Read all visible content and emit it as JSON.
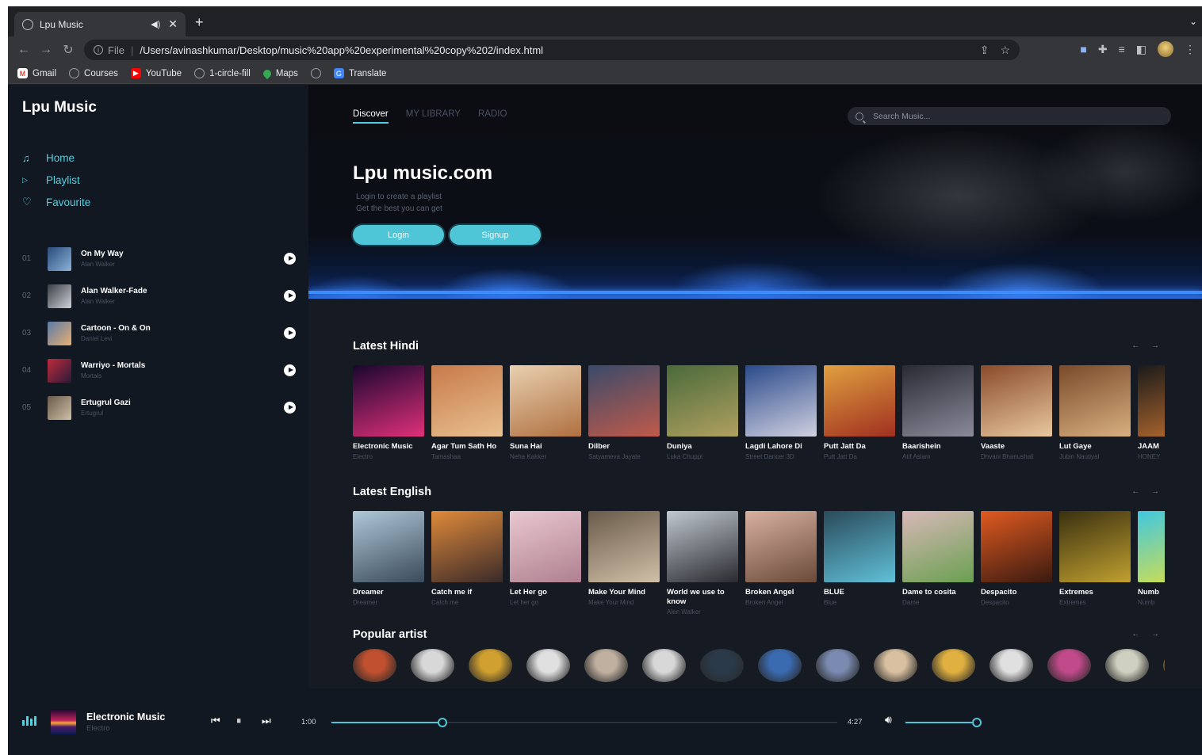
{
  "browser": {
    "tab_title": "Lpu Music",
    "new_tab": "+",
    "url_scheme": "File",
    "url": "/Users/avinashkumar/Desktop/music%20app%20experimental%20copy%202/index.html",
    "bookmarks": [
      {
        "label": "Gmail",
        "icon": "gmail-icon"
      },
      {
        "label": "Courses",
        "icon": "globe-icon"
      },
      {
        "label": "YouTube",
        "icon": "youtube-icon"
      },
      {
        "label": "1-circle-fill",
        "icon": "globe-icon"
      },
      {
        "label": "Maps",
        "icon": "maps-icon"
      },
      {
        "label": "",
        "icon": "globe-icon"
      },
      {
        "label": "Translate",
        "icon": "translate-icon"
      }
    ]
  },
  "sidebar": {
    "brand": "Lpu Music",
    "nav": [
      {
        "label": "Home",
        "icon": "music-note-icon"
      },
      {
        "label": "Playlist",
        "icon": "play-icon"
      },
      {
        "label": "Favourite",
        "icon": "heart-icon"
      }
    ],
    "playlist": [
      {
        "num": "01",
        "title": "On My Way",
        "artist": "Alan Walker",
        "color1": "#2a4a7a",
        "color2": "#8ab4d8"
      },
      {
        "num": "02",
        "title": "Alan Walker-Fade",
        "artist": "Alan Walker",
        "color1": "#3a3d44",
        "color2": "#cfd3d8"
      },
      {
        "num": "03",
        "title": "Cartoon - On & On",
        "artist": "Daniel Levi",
        "color1": "#5a7aa8",
        "color2": "#e8b070"
      },
      {
        "num": "04",
        "title": "Warriyo - Mortals",
        "artist": "Mortals",
        "color1": "#c02a3a",
        "color2": "#2a1a3a"
      },
      {
        "num": "05",
        "title": "Ertugrul Gazi",
        "artist": "Ertugrul",
        "color1": "#6a5a4a",
        "color2": "#cfc0a8"
      }
    ]
  },
  "main": {
    "tabs": [
      "Discover",
      "MY LIBRARY",
      "RADIO"
    ],
    "search_placeholder": "Search Music...",
    "hero_title": "Lpu music.com",
    "hero_line1": "Login to create a playlist",
    "hero_line2": "Get the best you can get",
    "login": "Login",
    "signup": "Signup",
    "arrows": "← →"
  },
  "sections": [
    {
      "title": "Latest Hindi",
      "items": [
        {
          "title": "Electronic Music",
          "sub": "Electro",
          "c1": "#1a0630",
          "c2": "#e0307a"
        },
        {
          "title": "Agar Tum Sath Ho",
          "sub": "Tamashaa",
          "c1": "#c87a4a",
          "c2": "#e8c090"
        },
        {
          "title": "Suna Hai",
          "sub": "Neha Kakker",
          "c1": "#e8d0b0",
          "c2": "#b07040"
        },
        {
          "title": "Dilber",
          "sub": "Satyameva Jayate",
          "c1": "#3a4a6a",
          "c2": "#c05a4a"
        },
        {
          "title": "Duniya",
          "sub": "Luka Chuppi",
          "c1": "#4a6a3a",
          "c2": "#b0a060"
        },
        {
          "title": "Lagdi Lahore Di",
          "sub": "Street Dancer 3D",
          "c1": "#2a4a8a",
          "c2": "#d0d0e0"
        },
        {
          "title": "Putt Jatt Da",
          "sub": "Putt Jatt Da",
          "c1": "#e0a040",
          "c2": "#a03020"
        },
        {
          "title": "Baarishein",
          "sub": "Atif Aslam",
          "c1": "#2a2a34",
          "c2": "#8a8a9a"
        },
        {
          "title": "Vaaste",
          "sub": "Dhvani Bhanushali",
          "c1": "#8a4a2a",
          "c2": "#e8c8a0"
        },
        {
          "title": "Lut Gaye",
          "sub": "Jubin Nautiyal",
          "c1": "#7a4a2a",
          "c2": "#d8b080"
        },
        {
          "title": "JAAM",
          "sub": "HONEY",
          "c1": "#1a1a1a",
          "c2": "#c07030"
        }
      ]
    },
    {
      "title": "Latest English",
      "items": [
        {
          "title": "Dreamer",
          "sub": "Dreamer",
          "c1": "#b0c8d8",
          "c2": "#3a4a5a"
        },
        {
          "title": "Catch me if",
          "sub": "Catch me",
          "c1": "#e08a3a",
          "c2": "#3a2a2a"
        },
        {
          "title": "Let Her go",
          "sub": "Let her go",
          "c1": "#e8c8d0",
          "c2": "#b08090"
        },
        {
          "title": "Make Your Mind",
          "sub": "Make Your Mind",
          "c1": "#6a5a4a",
          "c2": "#d0c0a8"
        },
        {
          "title": "World we use to know",
          "sub": "Alen Walker",
          "c1": "#c0c8d0",
          "c2": "#2a2a30"
        },
        {
          "title": "Broken Angel",
          "sub": "Broken Angel",
          "c1": "#d8b0a0",
          "c2": "#6a4a3a"
        },
        {
          "title": "BLUE",
          "sub": "Blue",
          "c1": "#2a4a5a",
          "c2": "#60c0d8"
        },
        {
          "title": "Dame to cosita",
          "sub": "Dame",
          "c1": "#d8b8b8",
          "c2": "#6aa050"
        },
        {
          "title": "Despacito",
          "sub": "Despacito",
          "c1": "#e05a20",
          "c2": "#3a1a10"
        },
        {
          "title": "Extremes",
          "sub": "Extremes",
          "c1": "#3a3010",
          "c2": "#c0a030"
        },
        {
          "title": "Numb",
          "sub": "Numb",
          "c1": "#40c8e0",
          "c2": "#e0e040"
        }
      ]
    }
  ],
  "artists": {
    "title": "Popular artist",
    "colors": [
      "#c05030",
      "#d8d8d8",
      "#d0a030",
      "#e0e0e0",
      "#c0b0a0",
      "#d8d8d8",
      "#2a3a4a",
      "#3a6ab0",
      "#7a8ab0",
      "#d8c0a0",
      "#e0b040",
      "#e0e0e0",
      "#c04a8a",
      "#d0d0c0",
      "#d0a040"
    ]
  },
  "player": {
    "title": "Electronic Music",
    "artist": "Electro",
    "current": "1:00",
    "total": "4:27",
    "progress": 0.22,
    "volume": 0.98
  }
}
